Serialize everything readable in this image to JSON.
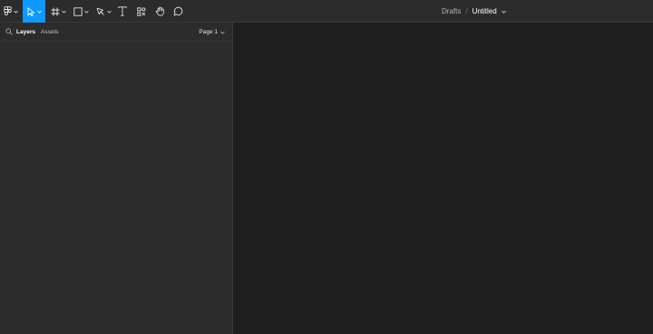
{
  "toolbar": {
    "main_menu_icon": "figma-logo-icon",
    "tools": [
      {
        "name": "move-tool",
        "icon": "pointer-icon",
        "active": true
      },
      {
        "name": "frame-tool",
        "icon": "hash-frame-icon",
        "active": false
      },
      {
        "name": "shape-tool",
        "icon": "rectangle-icon",
        "active": false
      },
      {
        "name": "pen-tool",
        "icon": "pen-icon",
        "active": false
      },
      {
        "name": "text-tool",
        "icon": "text-icon",
        "active": false
      },
      {
        "name": "resources-tool",
        "icon": "resources-icon",
        "active": false
      },
      {
        "name": "hand-tool",
        "icon": "hand-icon",
        "active": false
      },
      {
        "name": "comment-tool",
        "icon": "comment-icon",
        "active": false
      }
    ],
    "breadcrumb_folder": "Drafts",
    "breadcrumb_separator": "/",
    "file_name": "Untitled"
  },
  "panel": {
    "tabs": {
      "layers": "Layers",
      "assets": "Assets"
    },
    "page_selector": "Page 1"
  },
  "colors": {
    "accent": "#0d99ff",
    "toolbar_bg": "#2c2c2c",
    "panel_bg": "#2c2c2c",
    "canvas_bg": "#1e1e1e"
  }
}
